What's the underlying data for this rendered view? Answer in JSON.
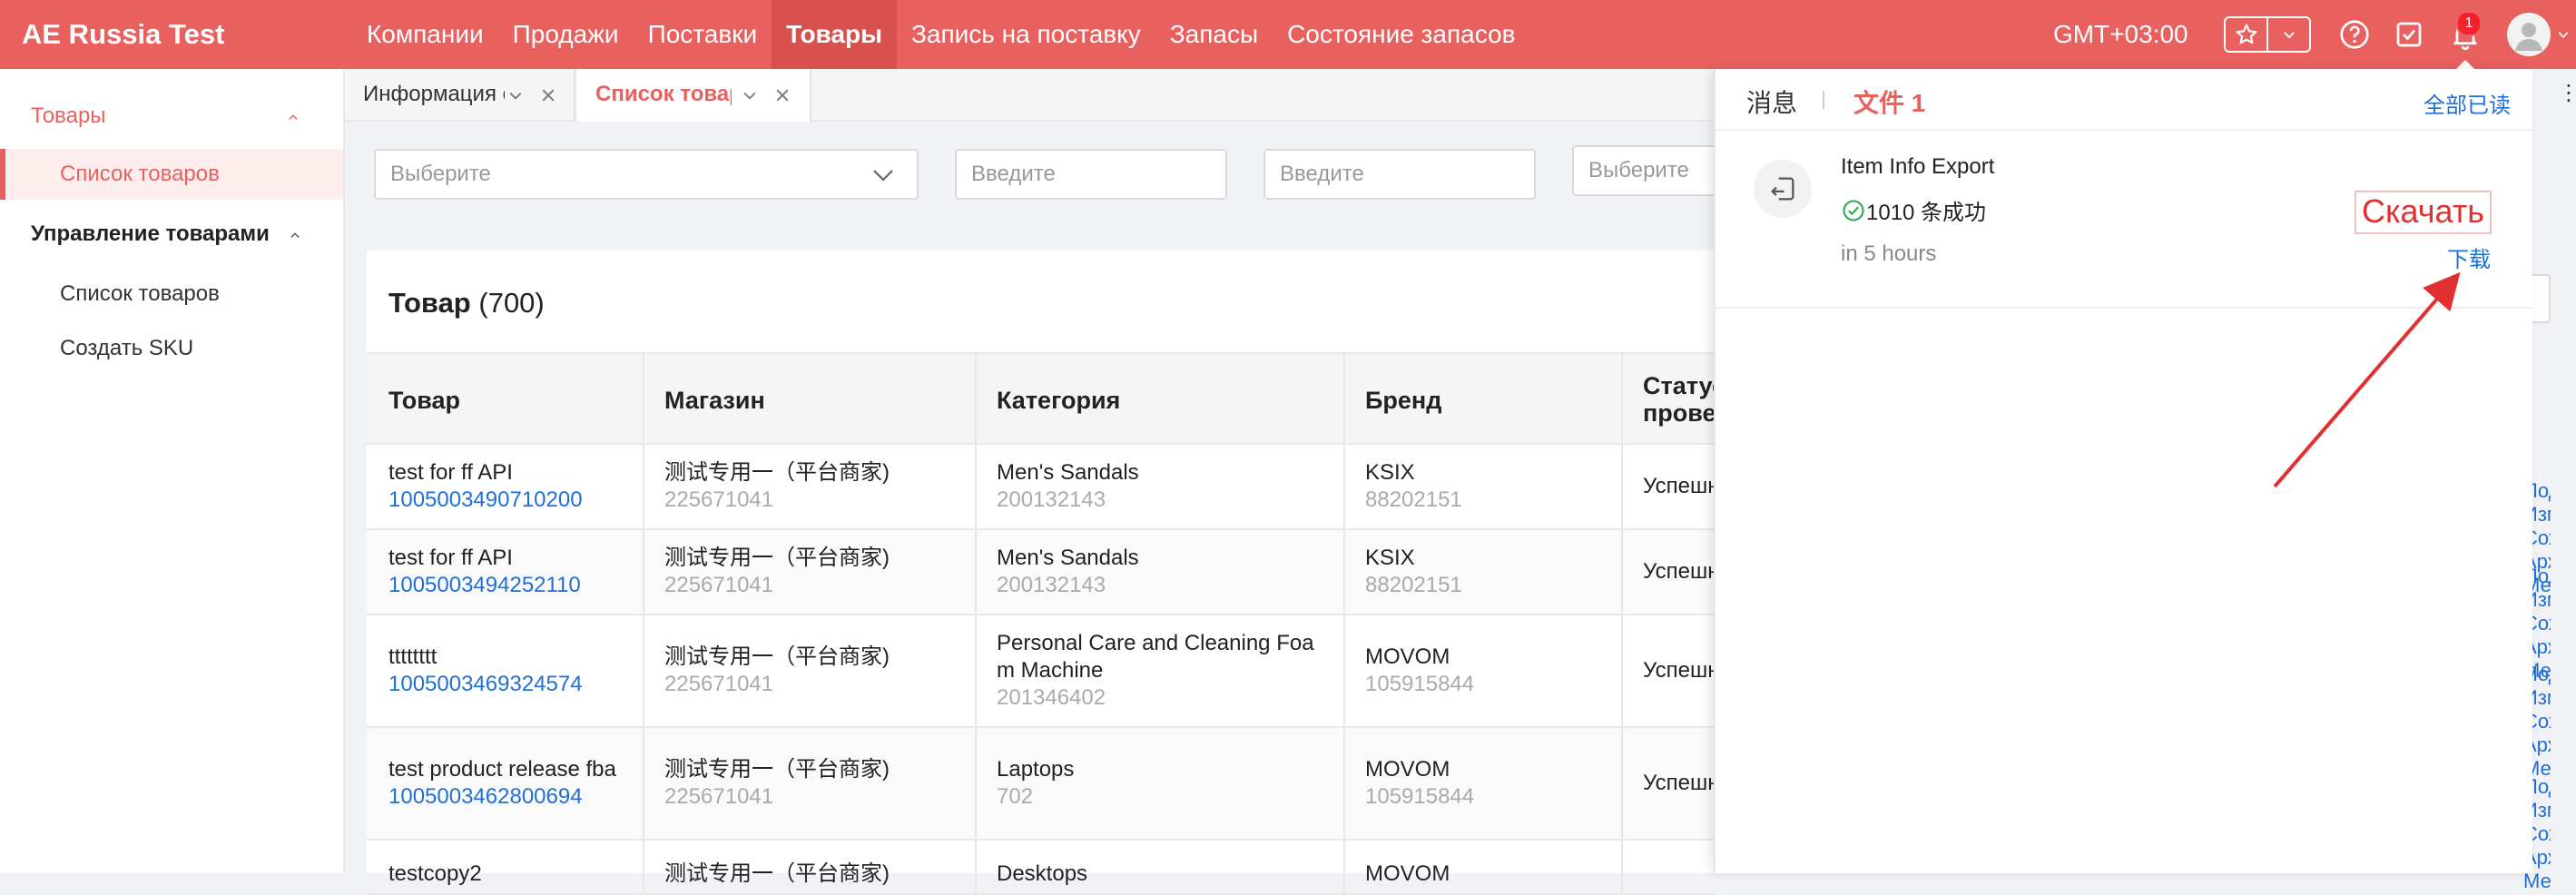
{
  "header": {
    "app_title": "AE Russia Test",
    "nav": [
      "Компании",
      "Продажи",
      "Поставки",
      "Товары",
      "Запись на поставку",
      "Запасы",
      "Состояние запасов"
    ],
    "active_nav": "Товары",
    "timezone": "GMT+03:00",
    "notification_count": "1"
  },
  "sidebar": {
    "group1": "Товары",
    "group1_item": "Список товаров",
    "group2": "Управление товарами",
    "group2_items": [
      "Список товаров",
      "Создать SKU"
    ]
  },
  "tabs": [
    {
      "label": "Информация о товаре"
    },
    {
      "label": "Список товаров"
    }
  ],
  "filters": {
    "shop_placeholder": "Выберите",
    "id_placeholder": "Введите",
    "name_placeholder": "Введите",
    "fourth_placeholder": "Выберите"
  },
  "card": {
    "title": "Товар",
    "count": "(700)"
  },
  "table": {
    "headers": [
      "Товар",
      "Магазин",
      "Категория",
      "Бренд",
      "Статус проверки"
    ],
    "rows": [
      {
        "name": "test for ff API",
        "id": "1005003490710200",
        "shop": "测试专用一（平台商家)",
        "shop_id": "225671041",
        "category": "Men's Sandals",
        "category_id": "200132143",
        "brand": "KSIX",
        "brand_id": "88202151",
        "status": "Успешно",
        "action": "Подробнее, Изменить, Сохранить, Архивировать, Метки"
      },
      {
        "name": "test for ff API",
        "id": "1005003494252110",
        "shop": "测试专用一（平台商家)",
        "shop_id": "225671041",
        "category": "Men's Sandals",
        "category_id": "200132143",
        "brand": "KSIX",
        "brand_id": "88202151",
        "status": "Успешно",
        "action": "Подробнее, Изменить, Сохранить, Архивировать, Метки"
      },
      {
        "name": "tttttttt",
        "id": "1005003469324574",
        "shop": "测试专用一（平台商家)",
        "shop_id": "225671041",
        "category": "Personal Care and Cleaning Foam Machine",
        "category_id": "201346402",
        "brand": "MOVOM",
        "brand_id": "105915844",
        "status": "Успешно",
        "action": "Подробнее, Изменить, Сохранить, Архивировать, Метки"
      },
      {
        "name": "test product release fba",
        "id": "1005003462800694",
        "shop": "测试专用一（平台商家)",
        "shop_id": "225671041",
        "category": "Laptops",
        "category_id": "702",
        "brand": "MOVOM",
        "brand_id": "105915844",
        "status": "Успешно",
        "action": "Подробнее, Изменить, Сохранить, Архивировать, Метки"
      },
      {
        "name": "testcopy2",
        "id": "",
        "shop": "测试专用一（平台商家)",
        "shop_id": "",
        "category": "Desktops",
        "category_id": "",
        "brand": "MOVOM",
        "brand_id": "",
        "status": "",
        "action": ""
      }
    ]
  },
  "notifications": {
    "tab_messages": "消息",
    "tab_files": "文件 1",
    "mark_all_read": "全部已读",
    "item": {
      "title": "Item Info Export",
      "status": "1010 条成功",
      "time": "in 5 hours",
      "download": "下载"
    }
  },
  "annotation": {
    "label": "Скачать",
    "color": "#e0302f"
  },
  "colors": {
    "brand": "#e8615f",
    "link": "#1f6fd6"
  }
}
